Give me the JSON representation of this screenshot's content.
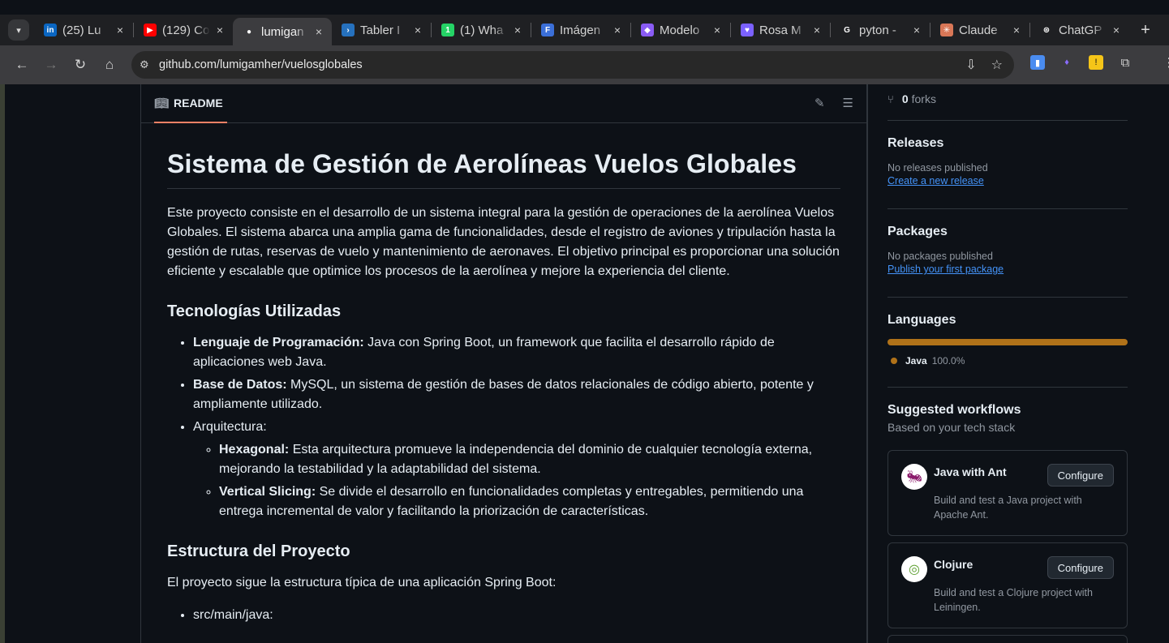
{
  "browser": {
    "tabs": [
      {
        "title": "(25) Lu",
        "favicon": "linkedin-icon",
        "color": "#0a66c2",
        "glyph": "in"
      },
      {
        "title": "(129) Co",
        "favicon": "youtube-icon",
        "color": "#ff0000",
        "glyph": "▶"
      },
      {
        "title": "lumigan",
        "favicon": "github-icon",
        "color": "#ffffff",
        "glyph": "●",
        "active": true
      },
      {
        "title": "Tabler I",
        "favicon": "powershell-icon",
        "color": "#2671be",
        "glyph": "›"
      },
      {
        "title": "(1) Wha",
        "favicon": "whatsapp-icon",
        "color": "#25d366",
        "glyph": "1"
      },
      {
        "title": "Imágen",
        "favicon": "doc-icon",
        "color": "#3b6fd8",
        "glyph": "F"
      },
      {
        "title": "Modelo",
        "favicon": "copilot-icon",
        "color": "#8a5cf5",
        "glyph": "◆"
      },
      {
        "title": "Rosa M",
        "favicon": "heart-icon",
        "color": "#7b61ff",
        "glyph": "♥"
      },
      {
        "title": "pyton -",
        "favicon": "google-icon",
        "color": "#ffffff",
        "glyph": "G"
      },
      {
        "title": "Claude",
        "favicon": "claude-icon",
        "color": "#d97757",
        "glyph": "✳"
      },
      {
        "title": "ChatGP",
        "favicon": "chatgpt-icon",
        "color": "#ffffff",
        "glyph": "⊛"
      }
    ],
    "url": "github.com/lumigamher/vuelosglobales"
  },
  "readme": {
    "tab_label": "README",
    "title": "Sistema de Gestión de Aerolíneas Vuelos Globales",
    "intro": "Este proyecto consiste en el desarrollo de un sistema integral para la gestión de operaciones de la aerolínea Vuelos Globales. El sistema abarca una amplia gama de funcionalidades, desde el registro de aviones y tripulación hasta la gestión de rutas, reservas de vuelo y mantenimiento de aeronaves. El objetivo principal es proporcionar una solución eficiente y escalable que optimice los procesos de la aerolínea y mejore la experiencia del cliente.",
    "tech_heading": "Tecnologías Utilizadas",
    "tech_items": [
      {
        "bold": "Lenguaje de Programación:",
        "text": " Java con Spring Boot, un framework que facilita el desarrollo rápido de aplicaciones web Java."
      },
      {
        "bold": "Base de Datos:",
        "text": " MySQL, un sistema de gestión de bases de datos relacionales de código abierto, potente y ampliamente utilizado."
      }
    ],
    "arch_label": "Arquitectura:",
    "arch_items": [
      {
        "bold": "Hexagonal:",
        "text": " Esta arquitectura promueve la independencia del dominio de cualquier tecnología externa, mejorando la testabilidad y la adaptabilidad del sistema."
      },
      {
        "bold": "Vertical Slicing:",
        "text": " Se divide el desarrollo en funcionalidades completas y entregables, permitiendo una entrega incremental de valor y facilitando la priorización de características."
      }
    ],
    "structure_heading": "Estructura del Proyecto",
    "structure_intro": "El proyecto sigue la estructura típica de una aplicación Spring Boot:",
    "structure_items": [
      "src/main/java:"
    ]
  },
  "sidebar": {
    "forks_count": "0",
    "forks_label": "forks",
    "releases": {
      "title": "Releases",
      "empty": "No releases published",
      "link": "Create a new release"
    },
    "packages": {
      "title": "Packages",
      "empty": "No packages published",
      "link": "Publish your first package"
    },
    "languages": {
      "title": "Languages",
      "name": "Java",
      "percent": "100.0%",
      "fraction": 1.0,
      "color": "#b07219"
    },
    "workflows": {
      "title": "Suggested workflows",
      "subtitle": "Based on your tech stack",
      "items": [
        {
          "name": "Java with Ant",
          "button": "Configure",
          "desc": "Build and test a Java project with Apache Ant."
        },
        {
          "name": "Clojure",
          "button": "Configure",
          "desc": "Build and test a Clojure project with Leiningen."
        }
      ]
    }
  }
}
